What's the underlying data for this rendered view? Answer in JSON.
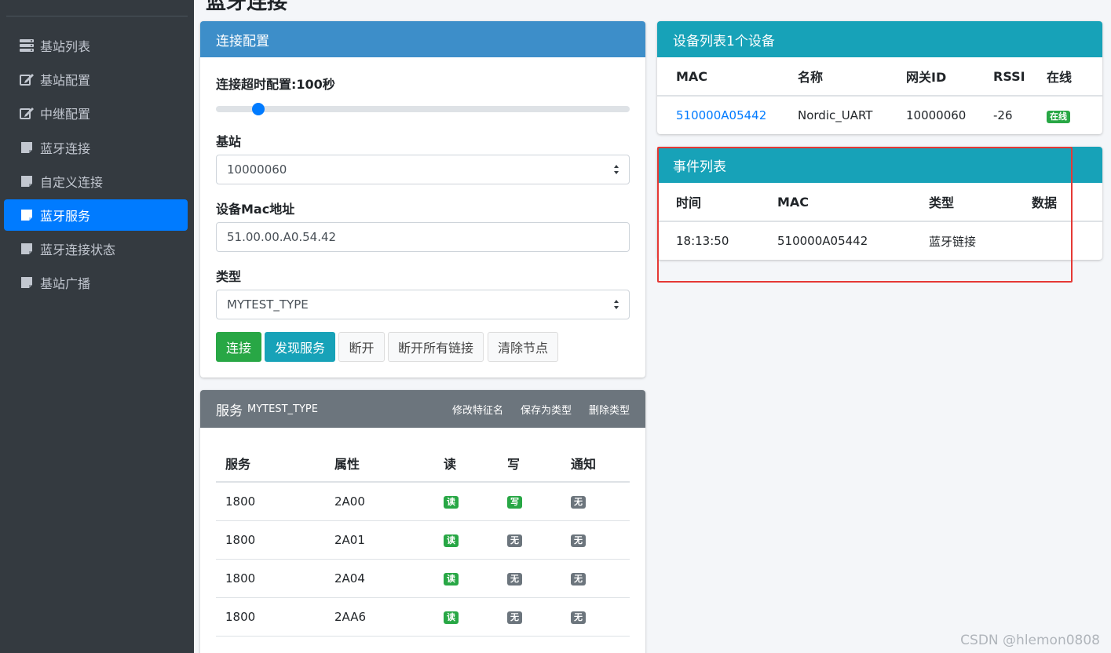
{
  "page_title_fragment": "蓝牙连接",
  "sidebar": {
    "items": [
      {
        "label": "基站列表",
        "icon": "server-icon",
        "active": false
      },
      {
        "label": "基站配置",
        "icon": "edit-icon",
        "active": false
      },
      {
        "label": "中继配置",
        "icon": "edit-icon",
        "active": false
      },
      {
        "label": "蓝牙连接",
        "icon": "note-icon",
        "active": false
      },
      {
        "label": "自定义连接",
        "icon": "note-icon",
        "active": false
      },
      {
        "label": "蓝牙服务",
        "icon": "note-icon",
        "active": true
      },
      {
        "label": "蓝牙连接状态",
        "icon": "note-icon",
        "active": false
      },
      {
        "label": "基站广播",
        "icon": "note-icon",
        "active": false
      }
    ]
  },
  "connection_config": {
    "title": "连接配置",
    "timeout_label": "连接超时配置:100秒",
    "timeout_value": 100,
    "base_station_label": "基站",
    "base_station_value": "10000060",
    "mac_label": "设备Mac地址",
    "mac_value": "51.00.00.A0.54.42",
    "type_label": "类型",
    "type_value": "MYTEST_TYPE",
    "buttons": {
      "connect": "连接",
      "discover": "发现服务",
      "disconnect": "断开",
      "disconnect_all": "断开所有链接",
      "clear_nodes": "清除节点"
    }
  },
  "service_card": {
    "title": "服务",
    "type_name": "MYTEST_TYPE",
    "links": {
      "edit": "修改特征名",
      "save": "保存为类型",
      "delete": "删除类型"
    },
    "columns": [
      "服务",
      "属性",
      "读",
      "写",
      "通知"
    ],
    "rows": [
      {
        "service": "1800",
        "attr": "2A00",
        "read": "读",
        "write": "写",
        "notify": "无"
      },
      {
        "service": "1800",
        "attr": "2A01",
        "read": "读",
        "write": "无",
        "notify": "无"
      },
      {
        "service": "1800",
        "attr": "2A04",
        "read": "读",
        "write": "无",
        "notify": "无"
      },
      {
        "service": "1800",
        "attr": "2AA6",
        "read": "读",
        "write": "无",
        "notify": "无"
      }
    ]
  },
  "device_list": {
    "title": "设备列表1个设备",
    "columns": [
      "MAC",
      "名称",
      "网关ID",
      "RSSI",
      "在线"
    ],
    "rows": [
      {
        "mac": "510000A05442",
        "name": "Nordic_UART",
        "gateway": "10000060",
        "rssi": "-26",
        "online": "在线"
      }
    ]
  },
  "event_list": {
    "title": "事件列表",
    "columns": [
      "时间",
      "MAC",
      "类型",
      "数据"
    ],
    "rows": [
      {
        "time": "18:13:50",
        "mac": "510000A05442",
        "type": "蓝牙链接",
        "data": ""
      }
    ]
  },
  "watermark": "CSDN @hlemon0808",
  "colors": {
    "sidebar_bg": "#343a40",
    "active": "#007bff",
    "primary_header": "#3d8ec9",
    "info_header": "#17a2b8",
    "secondary_header": "#6c757d",
    "success": "#28a745",
    "highlight_border": "#e53935"
  }
}
